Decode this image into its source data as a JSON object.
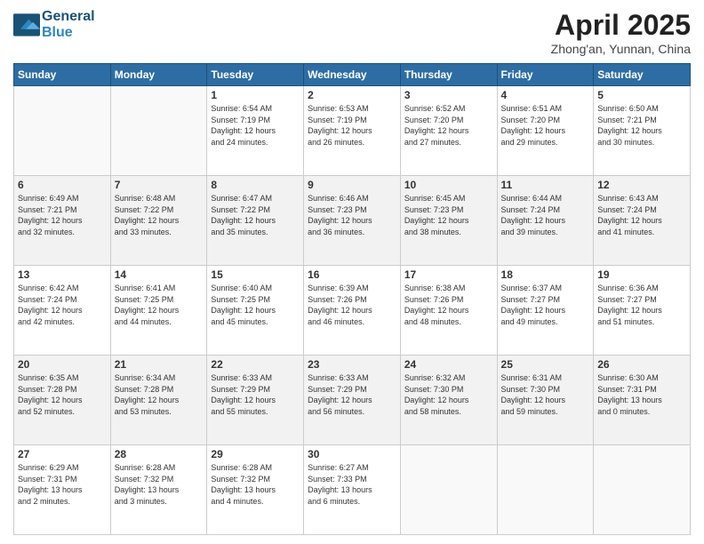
{
  "header": {
    "logo_line1": "General",
    "logo_line2": "Blue",
    "month": "April 2025",
    "location": "Zhong'an, Yunnan, China"
  },
  "weekdays": [
    "Sunday",
    "Monday",
    "Tuesday",
    "Wednesday",
    "Thursday",
    "Friday",
    "Saturday"
  ],
  "weeks": [
    [
      {
        "day": "",
        "info": ""
      },
      {
        "day": "",
        "info": ""
      },
      {
        "day": "1",
        "info": "Sunrise: 6:54 AM\nSunset: 7:19 PM\nDaylight: 12 hours\nand 24 minutes."
      },
      {
        "day": "2",
        "info": "Sunrise: 6:53 AM\nSunset: 7:19 PM\nDaylight: 12 hours\nand 26 minutes."
      },
      {
        "day": "3",
        "info": "Sunrise: 6:52 AM\nSunset: 7:20 PM\nDaylight: 12 hours\nand 27 minutes."
      },
      {
        "day": "4",
        "info": "Sunrise: 6:51 AM\nSunset: 7:20 PM\nDaylight: 12 hours\nand 29 minutes."
      },
      {
        "day": "5",
        "info": "Sunrise: 6:50 AM\nSunset: 7:21 PM\nDaylight: 12 hours\nand 30 minutes."
      }
    ],
    [
      {
        "day": "6",
        "info": "Sunrise: 6:49 AM\nSunset: 7:21 PM\nDaylight: 12 hours\nand 32 minutes."
      },
      {
        "day": "7",
        "info": "Sunrise: 6:48 AM\nSunset: 7:22 PM\nDaylight: 12 hours\nand 33 minutes."
      },
      {
        "day": "8",
        "info": "Sunrise: 6:47 AM\nSunset: 7:22 PM\nDaylight: 12 hours\nand 35 minutes."
      },
      {
        "day": "9",
        "info": "Sunrise: 6:46 AM\nSunset: 7:23 PM\nDaylight: 12 hours\nand 36 minutes."
      },
      {
        "day": "10",
        "info": "Sunrise: 6:45 AM\nSunset: 7:23 PM\nDaylight: 12 hours\nand 38 minutes."
      },
      {
        "day": "11",
        "info": "Sunrise: 6:44 AM\nSunset: 7:24 PM\nDaylight: 12 hours\nand 39 minutes."
      },
      {
        "day": "12",
        "info": "Sunrise: 6:43 AM\nSunset: 7:24 PM\nDaylight: 12 hours\nand 41 minutes."
      }
    ],
    [
      {
        "day": "13",
        "info": "Sunrise: 6:42 AM\nSunset: 7:24 PM\nDaylight: 12 hours\nand 42 minutes."
      },
      {
        "day": "14",
        "info": "Sunrise: 6:41 AM\nSunset: 7:25 PM\nDaylight: 12 hours\nand 44 minutes."
      },
      {
        "day": "15",
        "info": "Sunrise: 6:40 AM\nSunset: 7:25 PM\nDaylight: 12 hours\nand 45 minutes."
      },
      {
        "day": "16",
        "info": "Sunrise: 6:39 AM\nSunset: 7:26 PM\nDaylight: 12 hours\nand 46 minutes."
      },
      {
        "day": "17",
        "info": "Sunrise: 6:38 AM\nSunset: 7:26 PM\nDaylight: 12 hours\nand 48 minutes."
      },
      {
        "day": "18",
        "info": "Sunrise: 6:37 AM\nSunset: 7:27 PM\nDaylight: 12 hours\nand 49 minutes."
      },
      {
        "day": "19",
        "info": "Sunrise: 6:36 AM\nSunset: 7:27 PM\nDaylight: 12 hours\nand 51 minutes."
      }
    ],
    [
      {
        "day": "20",
        "info": "Sunrise: 6:35 AM\nSunset: 7:28 PM\nDaylight: 12 hours\nand 52 minutes."
      },
      {
        "day": "21",
        "info": "Sunrise: 6:34 AM\nSunset: 7:28 PM\nDaylight: 12 hours\nand 53 minutes."
      },
      {
        "day": "22",
        "info": "Sunrise: 6:33 AM\nSunset: 7:29 PM\nDaylight: 12 hours\nand 55 minutes."
      },
      {
        "day": "23",
        "info": "Sunrise: 6:33 AM\nSunset: 7:29 PM\nDaylight: 12 hours\nand 56 minutes."
      },
      {
        "day": "24",
        "info": "Sunrise: 6:32 AM\nSunset: 7:30 PM\nDaylight: 12 hours\nand 58 minutes."
      },
      {
        "day": "25",
        "info": "Sunrise: 6:31 AM\nSunset: 7:30 PM\nDaylight: 12 hours\nand 59 minutes."
      },
      {
        "day": "26",
        "info": "Sunrise: 6:30 AM\nSunset: 7:31 PM\nDaylight: 13 hours\nand 0 minutes."
      }
    ],
    [
      {
        "day": "27",
        "info": "Sunrise: 6:29 AM\nSunset: 7:31 PM\nDaylight: 13 hours\nand 2 minutes."
      },
      {
        "day": "28",
        "info": "Sunrise: 6:28 AM\nSunset: 7:32 PM\nDaylight: 13 hours\nand 3 minutes."
      },
      {
        "day": "29",
        "info": "Sunrise: 6:28 AM\nSunset: 7:32 PM\nDaylight: 13 hours\nand 4 minutes."
      },
      {
        "day": "30",
        "info": "Sunrise: 6:27 AM\nSunset: 7:33 PM\nDaylight: 13 hours\nand 6 minutes."
      },
      {
        "day": "",
        "info": ""
      },
      {
        "day": "",
        "info": ""
      },
      {
        "day": "",
        "info": ""
      }
    ]
  ]
}
